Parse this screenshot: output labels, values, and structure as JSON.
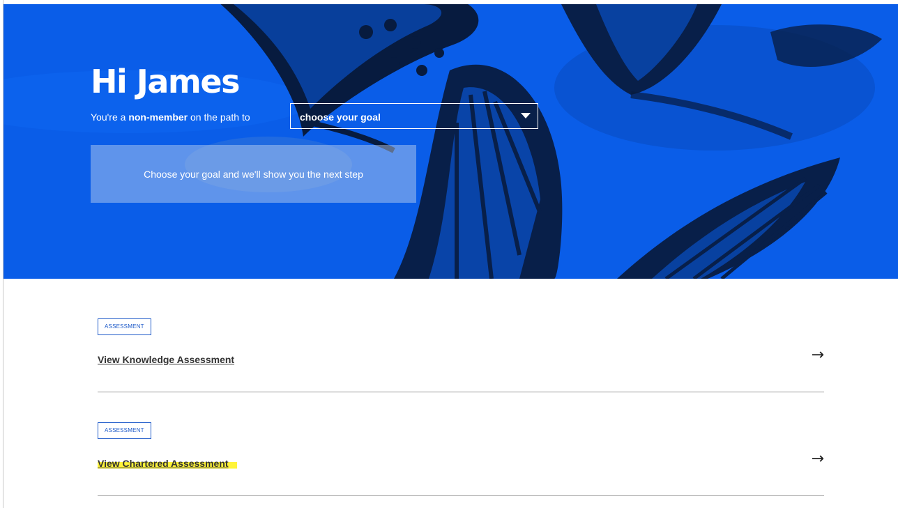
{
  "hero": {
    "greeting": "Hi James",
    "status_prefix": "You're a ",
    "membership": "non-member",
    "status_suffix": " on the path to",
    "goal_select": {
      "selected": "choose your goal"
    },
    "next_step_text": "Choose your goal and we'll show you the next step"
  },
  "items": [
    {
      "badge": "ASSESSMENT",
      "link": "View Knowledge Assessment",
      "arrow_icon": "arrow-right-icon"
    },
    {
      "badge": "ASSESSMENT",
      "link": "View Chartered Assessment",
      "arrow_icon": "arrow-right-icon"
    }
  ],
  "colors": {
    "hero_blue": "#0a5de8",
    "badge_blue": "#1f5bc9",
    "highlight": "#fff43a"
  }
}
